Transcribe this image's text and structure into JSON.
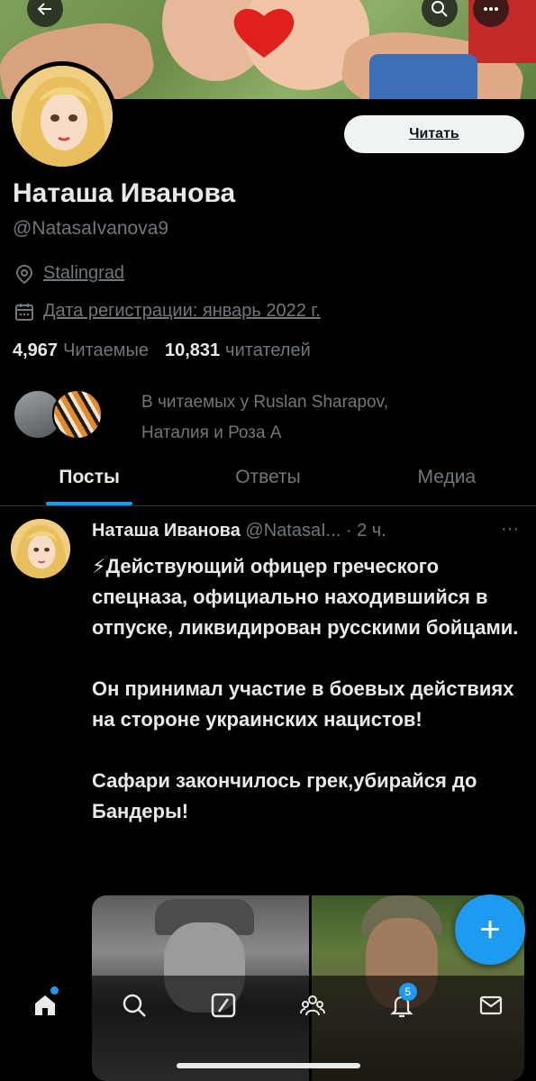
{
  "profile": {
    "name": "Наташа Иванова",
    "handle": "@NatasaIvanova9",
    "location": "Stalingrad",
    "joined": "Дата регистрации: январь 2022 г.",
    "following_count": "4,967",
    "following_label": "Читаемые",
    "followers_count": "10,831",
    "followers_label": "читателей",
    "follow_button": "Читать",
    "known_followers_line1": "В читаемых у Ruslan Sharapov,",
    "known_followers_line2": "Наталия и Роза А"
  },
  "tabs": [
    {
      "label": "Посты",
      "active": true
    },
    {
      "label": "Ответы",
      "active": false
    },
    {
      "label": "Медиа",
      "active": false
    }
  ],
  "post": {
    "author_name": "Наташа Иванова",
    "author_handle": "@NatasaI...",
    "time": "· 2 ч.",
    "more": "···",
    "text": "⚡Действующий офицер греческого спецназа, официально находившийся в отпуске, ликвидирован русскими бойцами.\n\nОн принимал участие в боевых действиях на стороне украинских нацистов!\n\nСафари закончилось грек,убирайся до Бандеры!"
  },
  "fab_label": "+",
  "nav": {
    "notification_badge": "5"
  },
  "colors": {
    "accent": "#1d9bf0",
    "background": "#000000",
    "muted": "#71767b",
    "text": "#e7e9ea"
  },
  "icons": [
    "back-arrow-icon",
    "search-icon",
    "more-icon",
    "location-pin-icon",
    "calendar-icon",
    "home-icon",
    "explore-icon",
    "grok-icon",
    "communities-icon",
    "notifications-icon",
    "messages-icon",
    "plus-icon"
  ]
}
